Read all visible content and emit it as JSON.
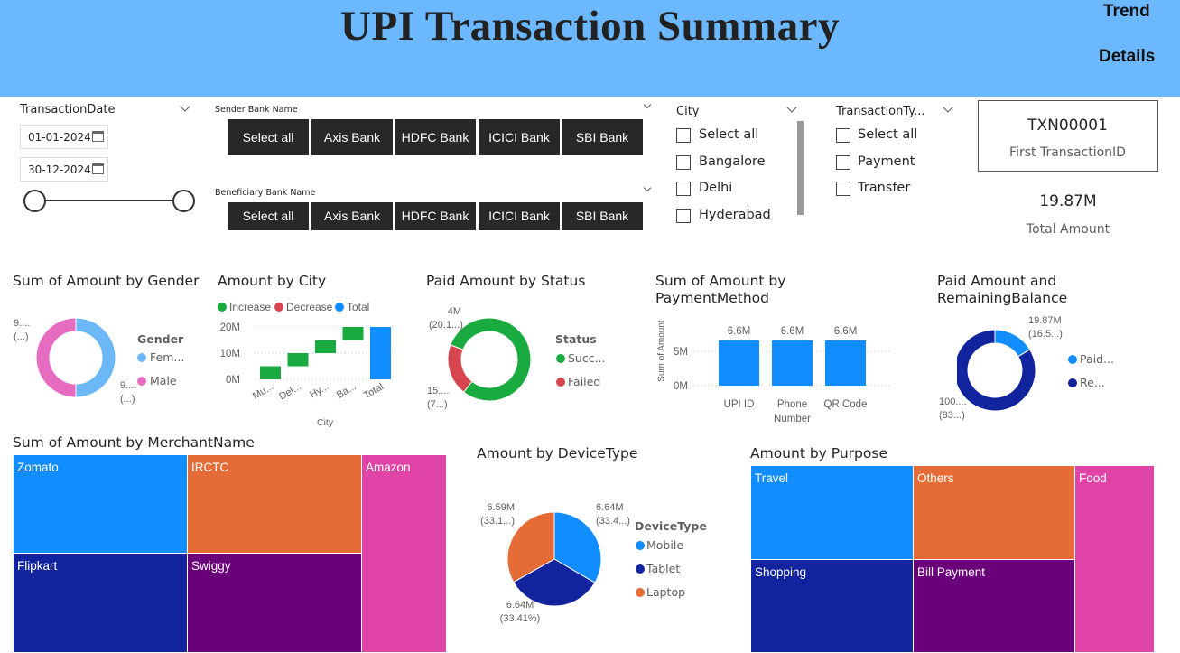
{
  "header": {
    "title": "UPI Transaction Summary",
    "nav": [
      "Trend",
      "Details"
    ]
  },
  "date_slicer": {
    "label": "TransactionDate",
    "start": "01-01-2024",
    "end": "30-12-2024"
  },
  "sender": {
    "label": "Sender Bank Name",
    "tiles": [
      "Select all",
      "Axis Bank",
      "HDFC Bank",
      "ICICI Bank",
      "SBI Bank"
    ]
  },
  "beneficiary": {
    "label": "Beneficiary Bank Name",
    "tiles": [
      "Select all",
      "Axis Bank",
      "HDFC Bank",
      "ICICI Bank",
      "SBI Bank"
    ]
  },
  "city_slicer": {
    "label": "City",
    "items": [
      "Select all",
      "Bangalore",
      "Delhi",
      "Hyderabad"
    ]
  },
  "type_slicer": {
    "label": "TransactionTy...",
    "items": [
      "Select all",
      "Payment",
      "Transfer"
    ]
  },
  "card": {
    "value": "TXN00001",
    "label": "First TransactionID"
  },
  "total": {
    "value": "19.87M",
    "label": "Total Amount"
  },
  "gender": {
    "title": "Sum of Amount by Gender",
    "legend_title": "Gender",
    "legend": [
      "Fem...",
      "Male"
    ],
    "label_top": [
      "9....",
      "(...)"
    ],
    "label_bottom": [
      "9....",
      "(...)"
    ],
    "colors": {
      "female": "#6cb8f6",
      "male": "#e66cc2"
    }
  },
  "city": {
    "title": "Amount by City",
    "legend": [
      "Increase",
      "Decrease",
      "Total"
    ],
    "yticks": [
      "20M",
      "10M",
      "0M"
    ],
    "xticks": [
      "Mu...",
      "Del...",
      "Hy...",
      "Ba...",
      "Total"
    ],
    "xlabel": "City",
    "colors": {
      "increase": "#1aab40",
      "decrease": "#d64550",
      "total": "#118dff"
    }
  },
  "status": {
    "title": "Paid Amount by Status",
    "legend_title": "Status",
    "legend": [
      "Succ...",
      "Failed"
    ],
    "label_top": [
      "4M",
      "(20.1...)"
    ],
    "label_bottom": [
      "15....",
      "(7...)"
    ],
    "colors": {
      "success": "#1aab40",
      "failed": "#d64550"
    }
  },
  "payment": {
    "title": "Sum of Amount by PaymentMethod",
    "title_lines": [
      "Sum of Amount by",
      "PaymentMethod"
    ],
    "ylabel": "Sum of Amount",
    "yticks": [
      "5M",
      "0M"
    ],
    "bar_labels": [
      "6.6M",
      "6.6M",
      "6.6M"
    ],
    "categories": [
      [
        "UPI ID"
      ],
      [
        "Phone",
        "Number"
      ],
      [
        "QR Code"
      ]
    ]
  },
  "balance": {
    "title_lines": [
      "Paid Amount and",
      "RemainingBalance"
    ],
    "legend": [
      "Paid...",
      "Re..."
    ],
    "label_top": [
      "19.87M",
      "(16.5...)"
    ],
    "label_bottom": [
      "100....",
      "(83...)"
    ],
    "colors": {
      "paid": "#118dff",
      "remaining": "#12239e"
    }
  },
  "merchant": {
    "title": "Sum of Amount by MerchantName",
    "items": [
      "Zomato",
      "IRCTC",
      "Amazon",
      "Flipkart",
      "Swiggy"
    ]
  },
  "device": {
    "title": "Amount by DeviceType",
    "legend_title": "DeviceType",
    "legend": [
      "Mobile",
      "Tablet",
      "Laptop"
    ],
    "labels": {
      "mobile": [
        "6.64M",
        "(33.4...)"
      ],
      "tablet": [
        "6.64M",
        "(33.41%)"
      ],
      "laptop": [
        "6.59M",
        "(33.1...)"
      ]
    }
  },
  "purpose": {
    "title": "Amount by Purpose",
    "items": [
      "Travel",
      "Others",
      "Food",
      "Shopping",
      "Bill Payment"
    ]
  },
  "colors": {
    "blue": "#118dff",
    "navy": "#12239e",
    "orange": "#e66c37",
    "purple": "#6b007b",
    "magenta": "#e044a7",
    "header": "#6cb8ff",
    "tile": "#282828"
  },
  "chart_data": [
    {
      "type": "pie",
      "title": "Sum of Amount by Gender",
      "categories": [
        "Fem...",
        "Male"
      ],
      "values": [
        50,
        50
      ]
    },
    {
      "type": "bar",
      "title": "Amount by City",
      "categories": [
        "Mu...",
        "Del...",
        "Hy...",
        "Ba...",
        "Total"
      ],
      "values": [
        5,
        5,
        5,
        5,
        20
      ],
      "xlabel": "City",
      "ylim": [
        0,
        20
      ]
    },
    {
      "type": "pie",
      "title": "Paid Amount by Status",
      "categories": [
        "Succ...",
        "Failed"
      ],
      "values": [
        79.9,
        20.1
      ]
    },
    {
      "type": "bar",
      "title": "Sum of Amount by PaymentMethod",
      "categories": [
        "UPI ID",
        "Phone Number",
        "QR Code"
      ],
      "values": [
        6.6,
        6.6,
        6.6
      ],
      "ylabel": "Sum of Amount",
      "ylim": [
        0,
        7
      ]
    },
    {
      "type": "pie",
      "title": "Paid Amount and RemainingBalance",
      "categories": [
        "Paid...",
        "Re..."
      ],
      "values": [
        16.5,
        83.5
      ]
    },
    {
      "type": "pie",
      "title": "Amount by DeviceType",
      "categories": [
        "Mobile",
        "Tablet",
        "Laptop"
      ],
      "values": [
        6.64,
        6.64,
        6.59
      ]
    }
  ]
}
